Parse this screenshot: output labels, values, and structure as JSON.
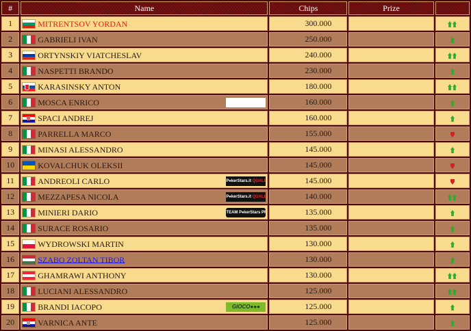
{
  "headers": {
    "num": "#",
    "name": "Name",
    "chips": "Chips",
    "prize": "Prize",
    "trend": ""
  },
  "colors": {
    "header_bg": "#7a1212",
    "row_light": "#f8db8c",
    "row_dark": "#b17c5a",
    "up": "#2faa2f",
    "down": "#d42020"
  },
  "rows": [
    {
      "rank": "1",
      "flag": "bg",
      "name": "MITRENTSOV YORDAN",
      "chips": "300.000",
      "prize": "",
      "trend": "up2",
      "sponsor": null
    },
    {
      "rank": "2",
      "flag": "it",
      "name": "GABRIELI IVAN",
      "chips": "250.000",
      "prize": "",
      "trend": "up",
      "sponsor": null
    },
    {
      "rank": "3",
      "flag": "ru",
      "name": "ORTYNSKIY VIATCHESLAV",
      "chips": "240.000",
      "prize": "",
      "trend": "up2",
      "sponsor": null
    },
    {
      "rank": "4",
      "flag": "it",
      "name": "NASPETTI BRANDO",
      "chips": "230.000",
      "prize": "",
      "trend": "up",
      "sponsor": null
    },
    {
      "rank": "5",
      "flag": "sk",
      "name": "KARASINSKY ANTON",
      "chips": "180.000",
      "prize": "",
      "trend": "up2",
      "sponsor": null
    },
    {
      "rank": "6",
      "flag": "it",
      "name": "MOSCA ENRICO",
      "chips": "160.000",
      "prize": "",
      "trend": "up",
      "sponsor": "white"
    },
    {
      "rank": "7",
      "flag": "hr",
      "name": "SPACI ANDREJ",
      "chips": "160.000",
      "prize": "",
      "trend": "up",
      "sponsor": null
    },
    {
      "rank": "8",
      "flag": "it",
      "name": "PARRELLA MARCO",
      "chips": "155.000",
      "prize": "",
      "trend": "down",
      "sponsor": null
    },
    {
      "rank": "9",
      "flag": "it",
      "name": "MINASI ALESSANDRO",
      "chips": "145.000",
      "prize": "",
      "trend": "up",
      "sponsor": null
    },
    {
      "rank": "10",
      "flag": "ua",
      "name": "KOVALCHUK OLEKSII",
      "chips": "145.000",
      "prize": "",
      "trend": "down",
      "sponsor": null
    },
    {
      "rank": "11",
      "flag": "it",
      "name": "ANDREOLI CARLO",
      "chips": "145.000",
      "prize": "",
      "trend": "down",
      "sponsor": "pokerstars"
    },
    {
      "rank": "12",
      "flag": "it",
      "name": "MEZZAPESA NICOLA",
      "chips": "140.000",
      "prize": "",
      "trend": "up2",
      "sponsor": "pokerstars"
    },
    {
      "rank": "13",
      "flag": "it",
      "name": "MINIERI DARIO",
      "chips": "135.000",
      "prize": "",
      "trend": "up",
      "sponsor": "team"
    },
    {
      "rank": "14",
      "flag": "it",
      "name": "SURACE ROSARIO",
      "chips": "135.000",
      "prize": "",
      "trend": "up",
      "sponsor": null
    },
    {
      "rank": "15",
      "flag": "pl",
      "name": "WYDROWSKI MARTIN",
      "chips": "130.000",
      "prize": "",
      "trend": "up",
      "sponsor": null
    },
    {
      "rank": "16",
      "flag": "hu",
      "name": "SZABO ZOLTAN TIBOR",
      "chips": "130.000",
      "prize": "",
      "trend": "up",
      "sponsor": null
    },
    {
      "rank": "17",
      "flag": "at",
      "name": "GHAMRAWI ANTHONY",
      "chips": "130.000",
      "prize": "",
      "trend": "up2",
      "sponsor": null
    },
    {
      "rank": "18",
      "flag": "it",
      "name": "LUCIANI ALESSANDRO",
      "chips": "125.000",
      "prize": "",
      "trend": "up2",
      "sponsor": null
    },
    {
      "rank": "19",
      "flag": "it",
      "name": "BRANDI IACOPO",
      "chips": "125.000",
      "prize": "",
      "trend": "up",
      "sponsor": "gioco"
    },
    {
      "rank": "20",
      "flag": "hr",
      "name": "VARNICA ANTE",
      "chips": "125.000",
      "prize": "",
      "trend": "up",
      "sponsor": null
    }
  ],
  "sponsors": {
    "white": {
      "parts": [
        "",
        ""
      ]
    },
    "pokerstars": {
      "parts": [
        "P♠kerStars.it ",
        "QUALIFIER"
      ]
    },
    "team": {
      "parts": [
        "TEAM P♠kerStars ",
        "PRO"
      ]
    },
    "gioco": {
      "parts": [
        "GIOCO",
        "●●●"
      ]
    }
  },
  "highlights": {
    "1": "red",
    "16": "link"
  }
}
